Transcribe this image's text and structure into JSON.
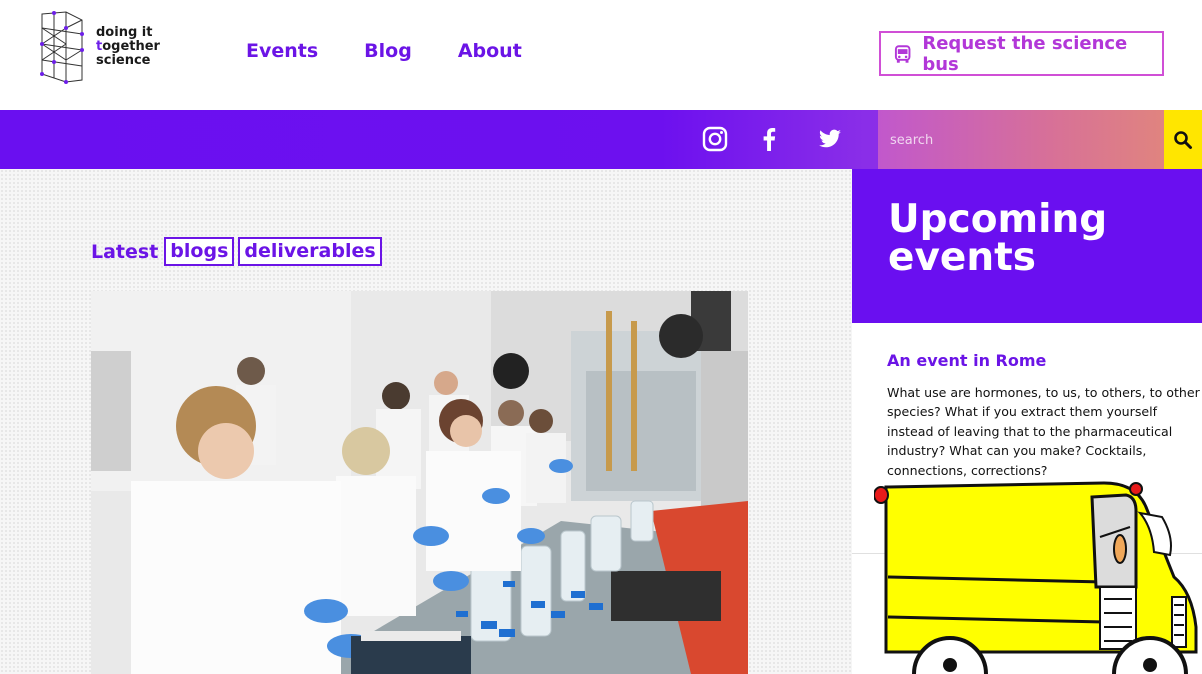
{
  "brand": {
    "logo_line1": "doing it",
    "logo_line2_accent": "t",
    "logo_line2_rest": "ogether",
    "logo_line3": "science",
    "accent": "#6b14e6"
  },
  "nav": {
    "items": [
      {
        "label": "Events"
      },
      {
        "label": "Blog"
      },
      {
        "label": "About"
      }
    ]
  },
  "cta": {
    "label": "Request the science bus",
    "icon": "bus-icon"
  },
  "social": {
    "icons": [
      "instagram-icon",
      "facebook-icon",
      "twitter-icon"
    ]
  },
  "search": {
    "placeholder": "search",
    "icon": "search-icon"
  },
  "latest": {
    "label": "Latest",
    "tabs": [
      {
        "label": "blogs"
      },
      {
        "label": "deliverables"
      }
    ]
  },
  "sidebar": {
    "heading": "Upcoming events",
    "event": {
      "title": "An event in Rome",
      "description": "What use are hormones, to us, to others, to other species? What if you extract them yourself instead of leaving that to the pharmaceutical industry? What can you make? Cocktails, connections, corrections?"
    }
  },
  "colors": {
    "band": "#6a0ff0",
    "search_gradient_start": "#c158cc",
    "search_gradient_end": "#e0847f",
    "search_button": "#ffe600",
    "cta_border": "#d04fd6",
    "bus_yellow": "#ffff00"
  }
}
